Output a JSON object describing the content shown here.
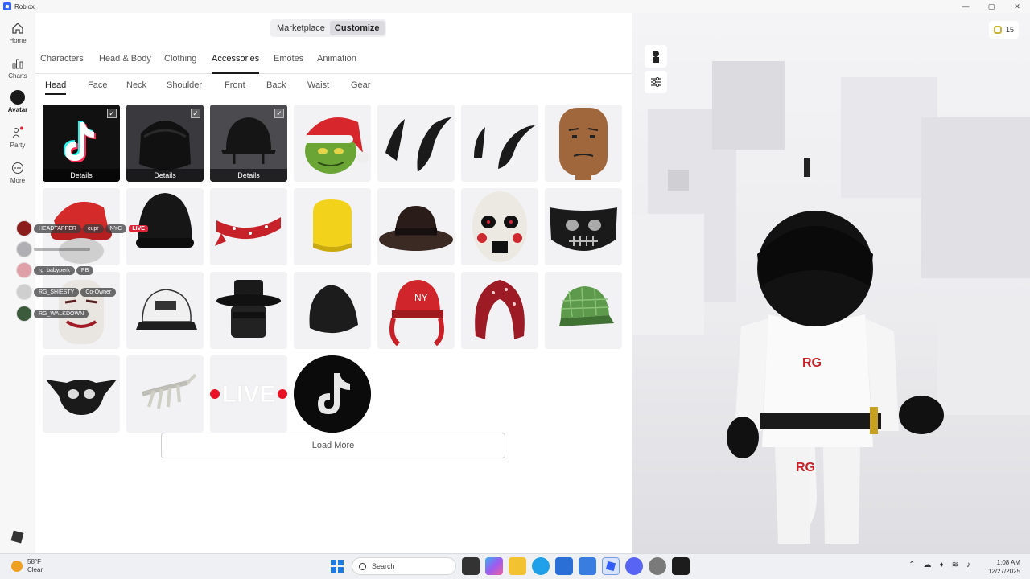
{
  "window": {
    "title": "Roblox",
    "controls": [
      "—",
      "▢",
      "✕"
    ]
  },
  "nav": {
    "items": [
      {
        "label": "Home",
        "icon": "home-icon"
      },
      {
        "label": "Charts",
        "icon": "charts-icon"
      },
      {
        "label": "Avatar",
        "icon": "avatar-icon"
      },
      {
        "label": "Party",
        "icon": "party-icon"
      },
      {
        "label": "More",
        "icon": "more-icon"
      }
    ]
  },
  "switcher": {
    "marketplace": "Marketplace",
    "customize": "Customize"
  },
  "categories": [
    "Characters",
    "Head & Body",
    "Clothing",
    "Accessories",
    "Emotes",
    "Animation"
  ],
  "subcategories": [
    "Head",
    "Face",
    "Neck",
    "Shoulder",
    "Front",
    "Back",
    "Waist",
    "Gear"
  ],
  "items": [
    {
      "name": "TikTok logo hat",
      "details": "Details",
      "equipped": true
    },
    {
      "name": "Black bandana hood",
      "details": "Details",
      "equipped": true
    },
    {
      "name": "Black helmet",
      "details": "Details",
      "equipped": true
    },
    {
      "name": "Grinch Santa hat"
    },
    {
      "name": "Black horns"
    },
    {
      "name": "Black horn single"
    },
    {
      "name": "Plain head"
    },
    {
      "name": "Red santa cap"
    },
    {
      "name": "Black beanie"
    },
    {
      "name": "Red bandana headband"
    },
    {
      "name": "Yellow block hat"
    },
    {
      "name": "Brown fedora"
    },
    {
      "name": "Jigsaw mask"
    },
    {
      "name": "Skull face mask"
    },
    {
      "name": "Joker head"
    },
    {
      "name": "White trucker cap"
    },
    {
      "name": "Black wide hat"
    },
    {
      "name": "Black beanie 2"
    },
    {
      "name": "NY red cap"
    },
    {
      "name": "Red bandana hood"
    },
    {
      "name": "Green plaid cap"
    },
    {
      "name": "Skull wing mask"
    },
    {
      "name": "Skeleton hand"
    },
    {
      "name": "LIVE sign",
      "text": "LIVE"
    },
    {
      "name": "TikTok circle"
    }
  ],
  "load_more": "Load More",
  "chat_overlay": [
    {
      "name": "HEADTAPPER",
      "badge": "cupr",
      "tag": "NYC",
      "live": "LIVE"
    },
    {
      "name": ""
    },
    {
      "name": "rg_babyperk",
      "tag": "PB"
    },
    {
      "name": "RG_SHIESTY",
      "tag": "Co-Owner"
    },
    {
      "name": "RG_WALKDOWN"
    }
  ],
  "preview": {
    "robux": "15"
  },
  "taskbar": {
    "weather_temp": "58°F",
    "weather_desc": "Clear",
    "search": "Search",
    "time": "1:08 AM",
    "date": "12/27/2025"
  },
  "colors": {
    "accent": "#335fff",
    "live": "#e02439",
    "tiktok_pink": "#fe2c55",
    "tiktok_cyan": "#25f4ee"
  }
}
